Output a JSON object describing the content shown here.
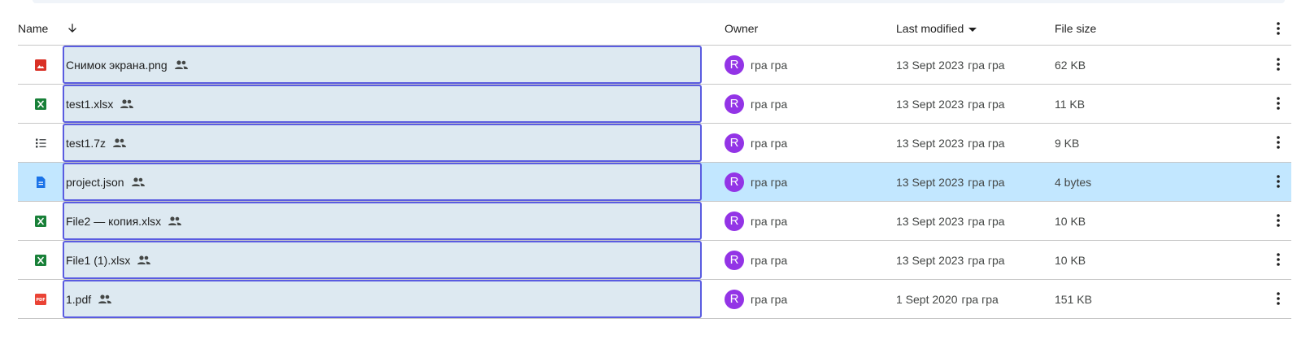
{
  "header": {
    "name_label": "Name",
    "owner_label": "Owner",
    "modified_label": "Last modified",
    "size_label": "File size",
    "sort_icon": "arrow-down-icon",
    "more_icon": "more-vert-icon"
  },
  "rows": [
    {
      "name": "Снимок экрана.png",
      "type": "image",
      "owner_initial": "R",
      "owner": "гра гра",
      "modified_date": "13 Sept 2023",
      "modified_by": "гра гра",
      "size": "62 KB",
      "selected": false
    },
    {
      "name": "test1.xlsx",
      "type": "spreadsheet",
      "owner_initial": "R",
      "owner": "гра гра",
      "modified_date": "13 Sept 2023",
      "modified_by": "гра гра",
      "size": "11 KB",
      "selected": false
    },
    {
      "name": "test1.7z",
      "type": "archive",
      "owner_initial": "R",
      "owner": "гра гра",
      "modified_date": "13 Sept 2023",
      "modified_by": "гра гра",
      "size": "9 KB",
      "selected": false
    },
    {
      "name": "project.json",
      "type": "document",
      "owner_initial": "R",
      "owner": "гра гра",
      "modified_date": "13 Sept 2023",
      "modified_by": "гра гра",
      "size": "4 bytes",
      "selected": true
    },
    {
      "name": "File2 — копия.xlsx",
      "type": "spreadsheet",
      "owner_initial": "R",
      "owner": "гра гра",
      "modified_date": "13 Sept 2023",
      "modified_by": "гра гра",
      "size": "10 KB",
      "selected": false
    },
    {
      "name": "File1 (1).xlsx",
      "type": "spreadsheet",
      "owner_initial": "R",
      "owner": "гра гра",
      "modified_date": "13 Sept 2023",
      "modified_by": "гра гра",
      "size": "10 KB",
      "selected": false
    },
    {
      "name": "1.pdf",
      "type": "pdf",
      "owner_initial": "R",
      "owner": "гра гра",
      "modified_date": "1 Sept 2020",
      "modified_by": "гра гра",
      "size": "151 KB",
      "selected": false
    }
  ],
  "colors": {
    "avatar": "#9334e6",
    "selected_row": "#c2e7ff",
    "name_highlight_border": "#5a5ce0",
    "name_highlight_fill": "#dde9f1",
    "image_icon": "#d93025",
    "spreadsheet_icon": "#188038",
    "document_icon": "#1a73e8",
    "pdf_icon": "#ea4335"
  }
}
